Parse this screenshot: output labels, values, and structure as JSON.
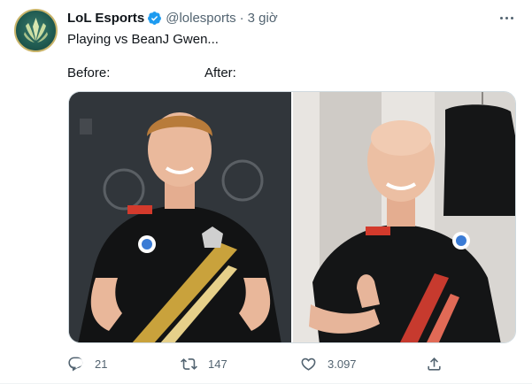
{
  "tweet": {
    "author_name": "LoL Esports",
    "handle": "@lolesports",
    "separator": "·",
    "time": "3 giờ",
    "text": "Playing vs BeanJ Gwen...",
    "before_label": "Before:",
    "after_label": "After:",
    "verified": true,
    "accent_color": "#1d9bf0"
  },
  "actions": {
    "reply_count": "21",
    "retweet_count": "147",
    "like_count": "3.097"
  },
  "icons": {
    "avatar": "lol-esports-logo",
    "verified": "verified-badge-icon",
    "more": "more-icon",
    "reply": "reply-icon",
    "retweet": "retweet-icon",
    "like": "like-icon",
    "share": "share-icon"
  }
}
